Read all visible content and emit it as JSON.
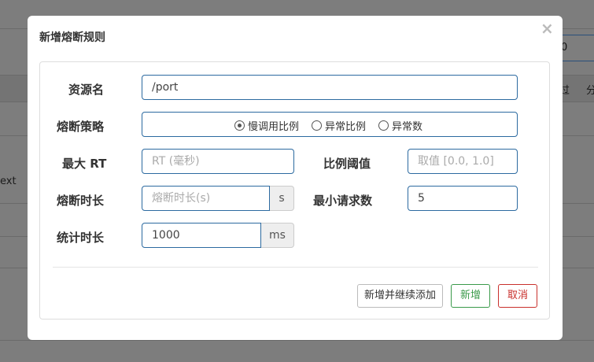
{
  "background": {
    "input_value": "0",
    "header_text_1": "过",
    "header_text_2": "分",
    "row_text": "ext"
  },
  "dialog": {
    "title": "新增熔断规则",
    "close_symbol": "×"
  },
  "form": {
    "resource": {
      "label": "资源名",
      "value": "/port"
    },
    "strategy": {
      "label": "熔断策略",
      "options": [
        {
          "label": "慢调用比例",
          "checked": true
        },
        {
          "label": "异常比例",
          "checked": false
        },
        {
          "label": "异常数",
          "checked": false
        }
      ]
    },
    "max_rt": {
      "label": "最大 RT",
      "placeholder": "RT (毫秒)"
    },
    "ratio_threshold": {
      "label": "比例阈值",
      "placeholder": "取值 [0.0, 1.0]"
    },
    "break_duration": {
      "label": "熔断时长",
      "placeholder": "熔断时长(s)",
      "unit": "s"
    },
    "min_requests": {
      "label": "最小请求数",
      "value": "5"
    },
    "stat_duration": {
      "label": "统计时长",
      "value": "1000",
      "unit": "ms"
    }
  },
  "buttons": {
    "add_continue": "新增并继续添加",
    "add": "新增",
    "cancel": "取消"
  }
}
